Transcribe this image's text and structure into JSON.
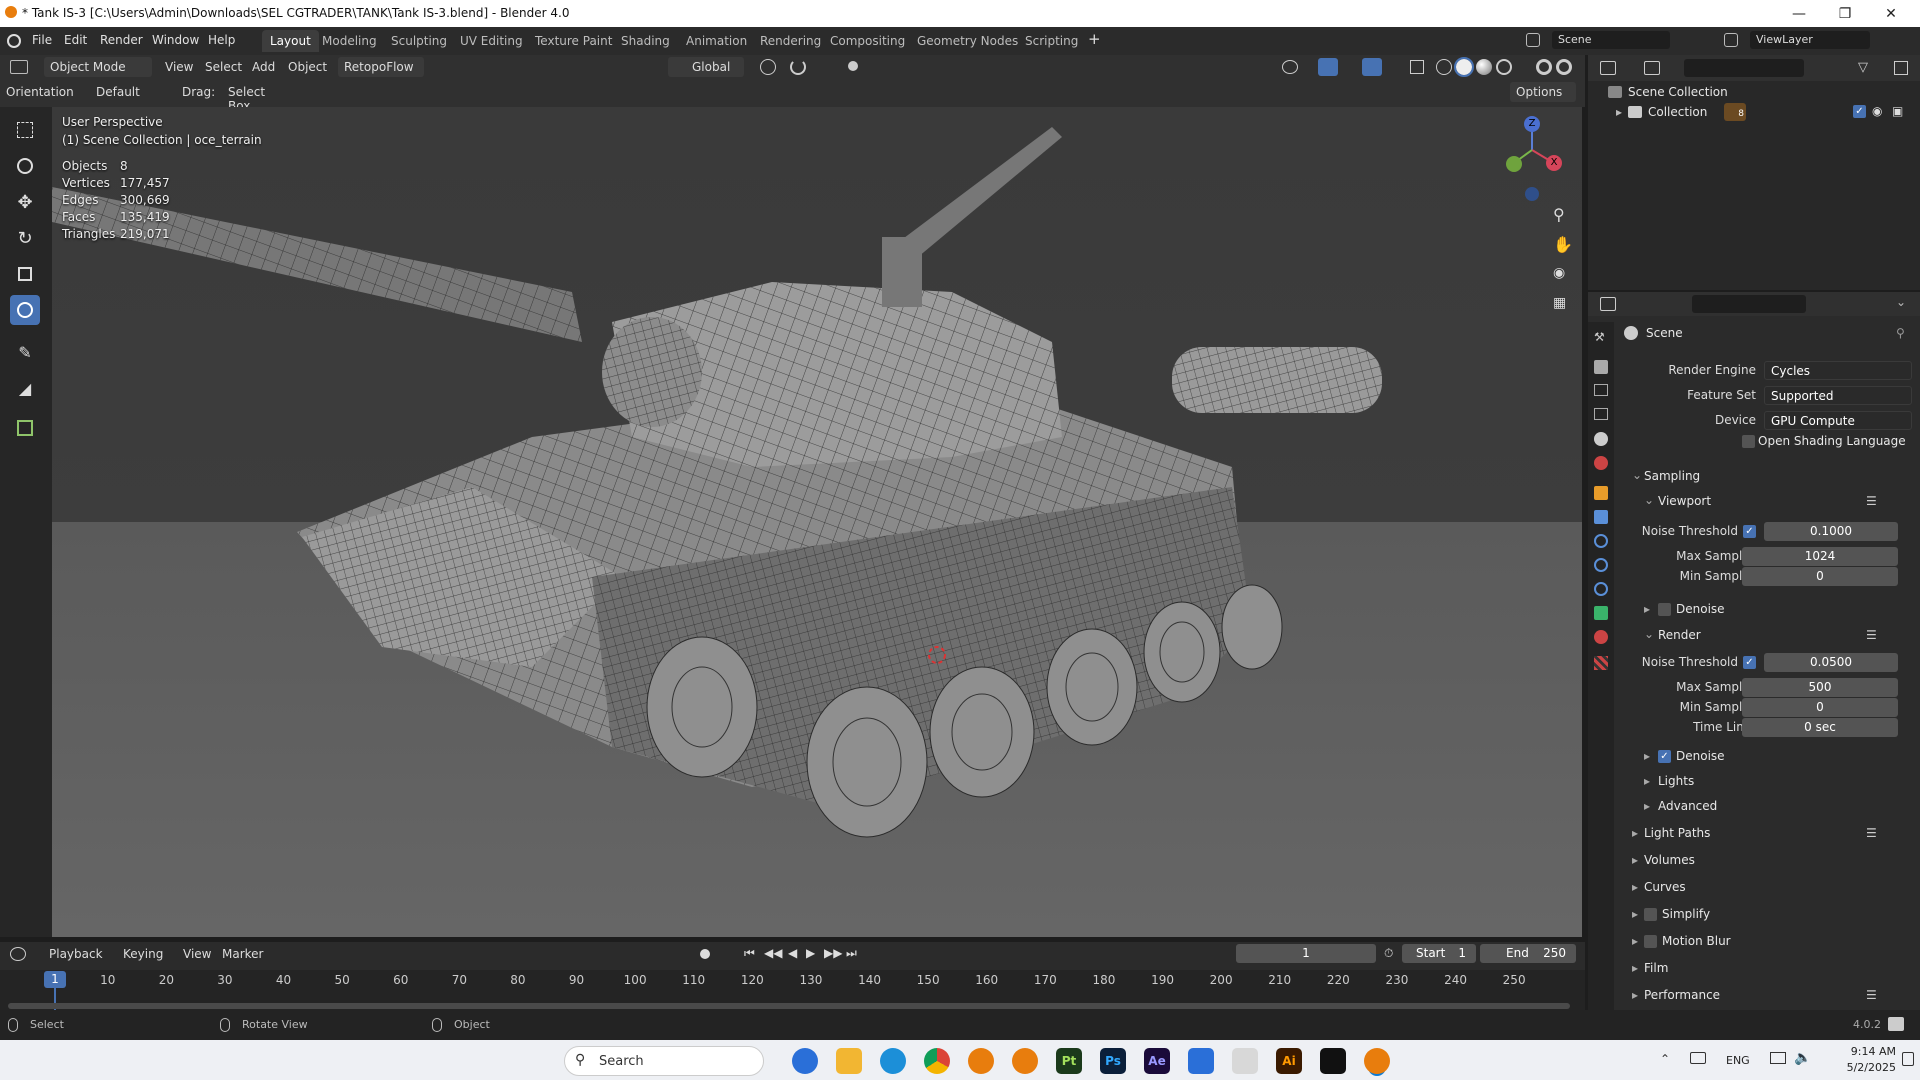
{
  "window": {
    "title": "* Tank IS-3 [C:\\Users\\Admin\\Downloads\\SEL CGTRADER\\TANK\\Tank IS-3.blend] - Blender 4.0"
  },
  "menu": [
    "File",
    "Edit",
    "Render",
    "Window",
    "Help"
  ],
  "workspaces": [
    {
      "label": "Layout",
      "active": true
    },
    {
      "label": "Modeling",
      "active": false
    },
    {
      "label": "Sculpting",
      "active": false
    },
    {
      "label": "UV Editing",
      "active": false
    },
    {
      "label": "Texture Paint",
      "active": false
    },
    {
      "label": "Shading",
      "active": false
    },
    {
      "label": "Animation",
      "active": false
    },
    {
      "label": "Rendering",
      "active": false
    },
    {
      "label": "Compositing",
      "active": false
    },
    {
      "label": "Geometry Nodes",
      "active": false
    },
    {
      "label": "Scripting",
      "active": false
    }
  ],
  "scene_field": "Scene",
  "viewlayer_field": "ViewLayer",
  "viewport_header": {
    "mode": "Object Mode",
    "menus": [
      "View",
      "Select",
      "Add",
      "Object"
    ],
    "addon": "RetopoFlow",
    "transform": "Global",
    "orientation_label": "Orientation:",
    "orientation_value": "Default",
    "drag_label": "Drag:",
    "drag_value": "Select Box",
    "options": "Options"
  },
  "viewport": {
    "perspective": "User Perspective",
    "collection": "(1) Scene Collection | oce_terrain",
    "stats": [
      {
        "label": "Objects",
        "value": "8"
      },
      {
        "label": "Vertices",
        "value": "177,457"
      },
      {
        "label": "Edges",
        "value": "300,669"
      },
      {
        "label": "Faces",
        "value": "135,419"
      },
      {
        "label": "Triangles",
        "value": "219,071"
      }
    ],
    "gizmo": {
      "z": "Z",
      "x": "X"
    }
  },
  "outliner": {
    "scene_collection": "Scene Collection",
    "collection": "Collection",
    "collection_count": "8"
  },
  "properties": {
    "header": "Scene",
    "render_engine_label": "Render Engine",
    "render_engine": "Cycles",
    "feature_set_label": "Feature Set",
    "feature_set": "Supported",
    "device_label": "Device",
    "device": "GPU Compute",
    "osl_label": "Open Shading Language",
    "sampling": "Sampling",
    "viewport_sub": "Viewport",
    "vp_noise_label": "Noise Threshold",
    "vp_noise": "0.1000",
    "vp_max_label": "Max Samples",
    "vp_max": "1024",
    "vp_min_label": "Min Samples",
    "vp_min": "0",
    "vp_denoise": "Denoise",
    "render_sub": "Render",
    "r_noise_label": "Noise Threshold",
    "r_noise": "0.0500",
    "r_max_label": "Max Samples",
    "r_max": "500",
    "r_min_label": "Min Samples",
    "r_min": "0",
    "r_time_label": "Time Limit",
    "r_time": "0 sec",
    "r_denoise": "Denoise",
    "lights": "Lights",
    "advanced": "Advanced",
    "sections": [
      "Light Paths",
      "Volumes",
      "Curves",
      "Simplify",
      "Motion Blur",
      "Film",
      "Performance"
    ]
  },
  "timeline": {
    "menus": [
      "Playback",
      "Keying",
      "View",
      "Marker"
    ],
    "current_frame": "1",
    "start_label": "Start",
    "start": "1",
    "end_label": "End",
    "end": "250",
    "ticks": [
      "1",
      "10",
      "20",
      "30",
      "40",
      "50",
      "60",
      "70",
      "80",
      "90",
      "100",
      "110",
      "120",
      "130",
      "140",
      "150",
      "160",
      "170",
      "180",
      "190",
      "200",
      "210",
      "220",
      "230",
      "240",
      "250"
    ]
  },
  "statusbar": {
    "select": "Select",
    "rotate": "Rotate View",
    "object": "Object",
    "version": "4.0.2"
  },
  "taskbar": {
    "search_placeholder": "Search",
    "lang": "ENG",
    "time": "9:14 AM",
    "date": "5/2/2025",
    "apps": [
      "Pt",
      "Ps",
      "Ae",
      "Ai"
    ]
  }
}
